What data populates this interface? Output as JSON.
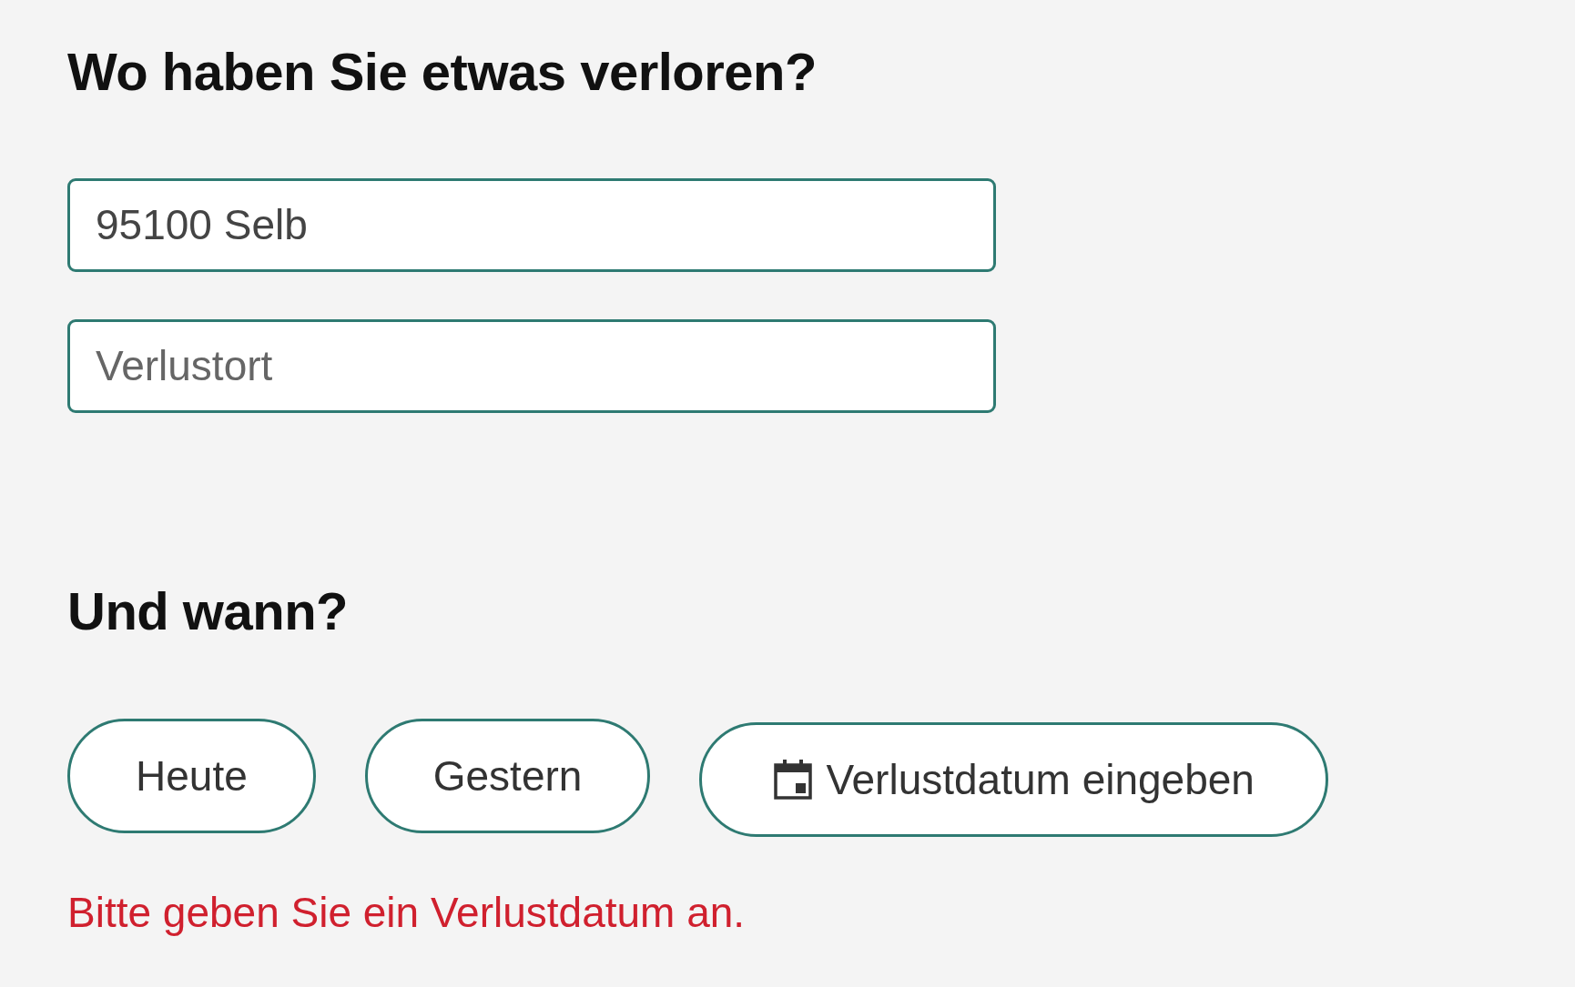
{
  "location_section": {
    "heading": "Wo haben Sie etwas verloren?",
    "fields": [
      {
        "value": "95100 Selb"
      },
      {
        "placeholder": "Verlustort"
      }
    ]
  },
  "date_section": {
    "heading": "Und wann?",
    "options": [
      {
        "label": "Heute",
        "kind": "plain",
        "selected": false
      },
      {
        "label": "Gestern",
        "kind": "plain",
        "selected": false
      },
      {
        "label": "Verlustdatum eingeben",
        "kind": "calendar",
        "selected": false
      }
    ],
    "error": "Bitte geben Sie ein Verlustdatum an."
  }
}
